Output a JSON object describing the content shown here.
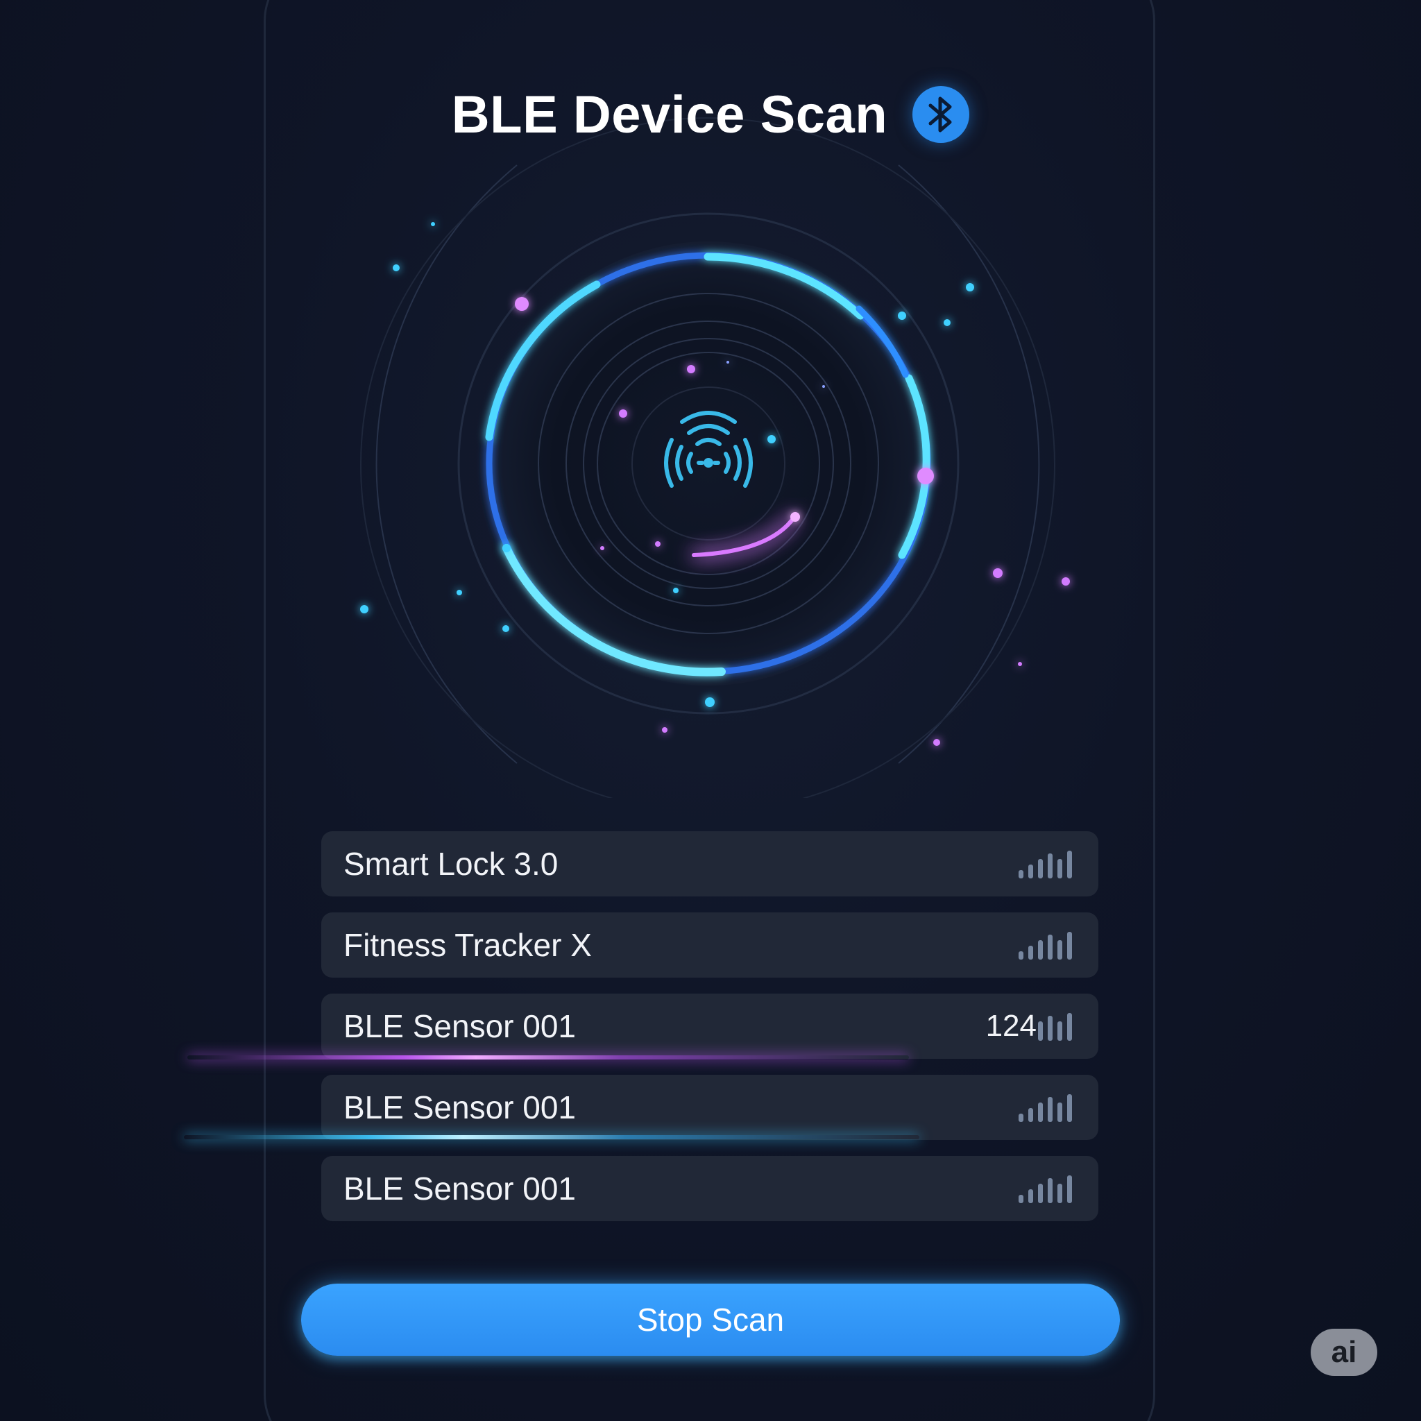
{
  "header": {
    "title": "BLE Device Scan",
    "status_icon": "bluetooth-icon"
  },
  "scanner": {
    "center_icon": "signal-broadcast-icon"
  },
  "devices": [
    {
      "name": "Smart Lock 3.0",
      "rssi": "",
      "signal_icon": "signal-strength-icon"
    },
    {
      "name": "Fitness Tracker X",
      "rssi": "",
      "signal_icon": "signal-strength-icon"
    },
    {
      "name": "BLE Sensor 001",
      "rssi": "124",
      "signal_icon": "signal-strength-icon"
    },
    {
      "name": "BLE Sensor 001",
      "rssi": "",
      "signal_icon": "signal-strength-icon"
    },
    {
      "name": "BLE Sensor 001",
      "rssi": "",
      "signal_icon": "signal-strength-icon"
    }
  ],
  "actions": {
    "stop_label": "Stop Scan"
  },
  "badge": {
    "label": "ai"
  },
  "colors": {
    "background": "#0e1424",
    "accent": "#2b8cf0",
    "ring_cyan": "#3fd0ff",
    "ring_blue": "#2f6fe8",
    "particle_purple": "#d66bff",
    "row_bg": "#212837",
    "signal_bar": "#7787a0"
  }
}
